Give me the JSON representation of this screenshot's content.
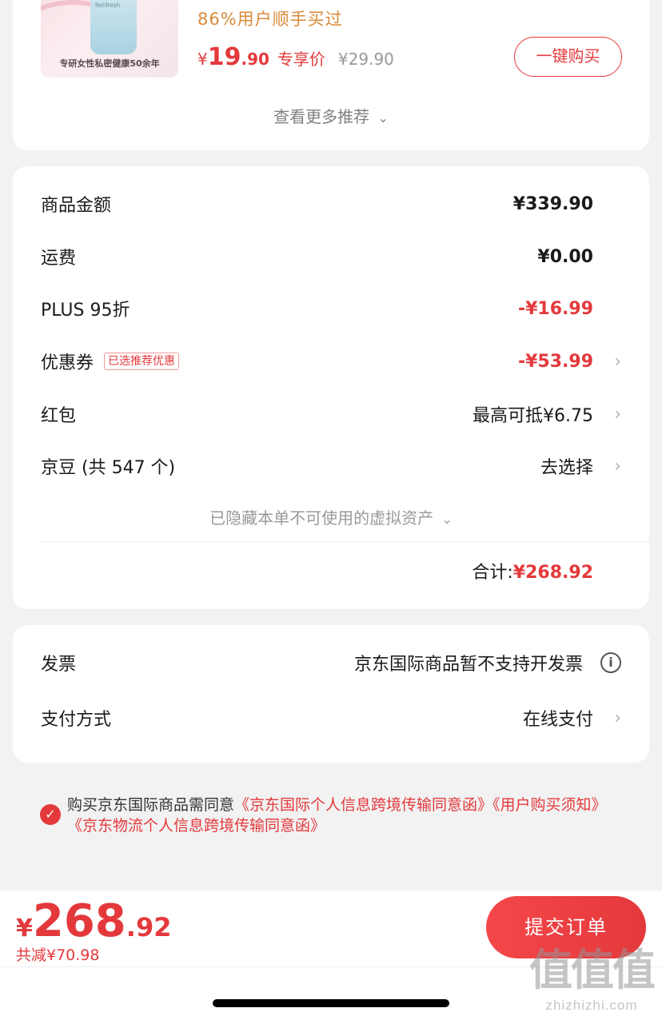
{
  "recommendation": {
    "image_caption": "专研女性私密健康50余年",
    "image_brand": "femfresh",
    "sold_text": "86%用户顺手买过",
    "price_yen": "¥",
    "price_int": "19",
    "price_dec": ".90",
    "price_tag": "专享价",
    "original_price": "¥29.90",
    "buy_label": "一键购买",
    "more_label": "查看更多推荐"
  },
  "amounts": {
    "rows": [
      {
        "label": "商品金额",
        "value": "¥339.90"
      },
      {
        "label": "运费",
        "value": "¥0.00"
      },
      {
        "label": "PLUS 95折",
        "value": "-¥16.99"
      },
      {
        "label": "优惠券",
        "badge": "已选推荐优惠",
        "value": "-¥53.99"
      },
      {
        "label": "红包",
        "value": "最高可抵¥6.75"
      },
      {
        "label": "京豆 (共 547 个)",
        "value": "去选择"
      }
    ],
    "hidden_assets": "已隐藏本单不可使用的虚拟资产",
    "total_label": "合计:",
    "total_value": "¥268.92"
  },
  "invoice": {
    "label": "发票",
    "value": "京东国际商品暂不支持开发票",
    "info_icon": "i"
  },
  "payment": {
    "label": "支付方式",
    "value": "在线支付"
  },
  "agreement": {
    "check": "✓",
    "prefix": "购买京东国际商品需同意",
    "links": "《京东国际个人信息跨境传输同意函》《用户购买须知》《京东物流个人信息跨境传输同意函》"
  },
  "bottom": {
    "yen": "¥",
    "total_int": "268",
    "total_dec": ".92",
    "saved": "共减¥70.98",
    "submit": "提交订单"
  },
  "watermark": {
    "big": "值值值",
    "small": "zhizhizhi.com"
  },
  "icons": {
    "chevron_right": "›",
    "chevron_down": "⌄"
  },
  "colors": {
    "accent": "#e4393c",
    "orange": "#d98a3a",
    "background": "#f2f2f2"
  }
}
